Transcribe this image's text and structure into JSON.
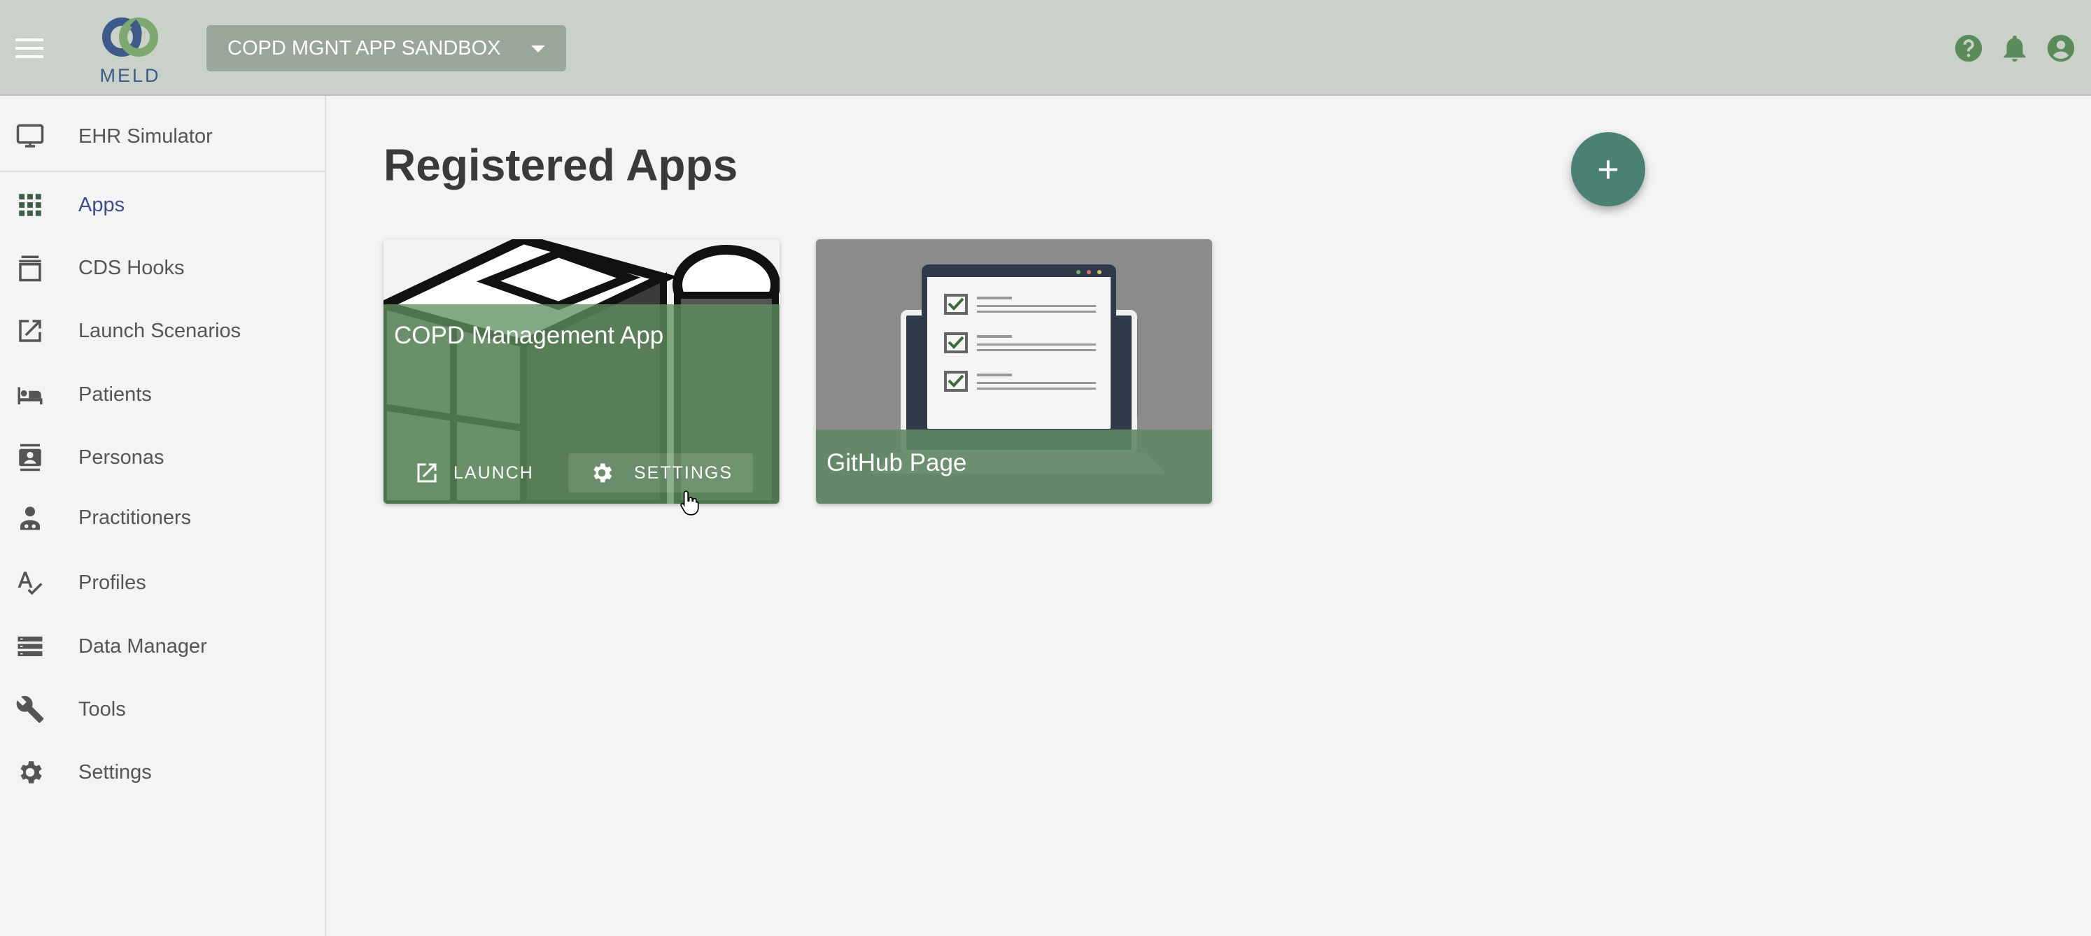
{
  "header": {
    "sandbox_name": "COPD MGNT APP SANDBOX",
    "logo_text": "MELD",
    "brand_colors": {
      "topbar": "#c9d1c8",
      "accent": "#4a8174",
      "logo_blue": "#3d5a8a",
      "logo_green": "#7ea870"
    },
    "icons": [
      "menu-icon",
      "help-icon",
      "bell-icon",
      "account-icon"
    ]
  },
  "sidebar": {
    "items": [
      {
        "label": "EHR Simulator",
        "icon": "monitor-icon",
        "active": false
      },
      {
        "label": "Apps",
        "icon": "apps-grid-icon",
        "active": true
      },
      {
        "label": "CDS Hooks",
        "icon": "cds-hooks-icon",
        "active": false
      },
      {
        "label": "Launch Scenarios",
        "icon": "open-in-new-icon",
        "active": false
      },
      {
        "label": "Patients",
        "icon": "hotel-bed-icon",
        "active": false
      },
      {
        "label": "Personas",
        "icon": "contact-card-icon",
        "active": false
      },
      {
        "label": "Practitioners",
        "icon": "doctor-icon",
        "active": false
      },
      {
        "label": "Profiles",
        "icon": "spellcheck-icon",
        "active": false
      },
      {
        "label": "Data Manager",
        "icon": "storage-icon",
        "active": false
      },
      {
        "label": "Tools",
        "icon": "wrench-icon",
        "active": false
      },
      {
        "label": "Settings",
        "icon": "gear-icon",
        "active": false
      }
    ]
  },
  "main": {
    "title": "Registered Apps",
    "fab_label": "+",
    "apps": [
      {
        "name": "COPD Management App",
        "launch_label": "LAUNCH",
        "settings_label": "SETTINGS"
      },
      {
        "name": "GitHub Page"
      }
    ]
  }
}
